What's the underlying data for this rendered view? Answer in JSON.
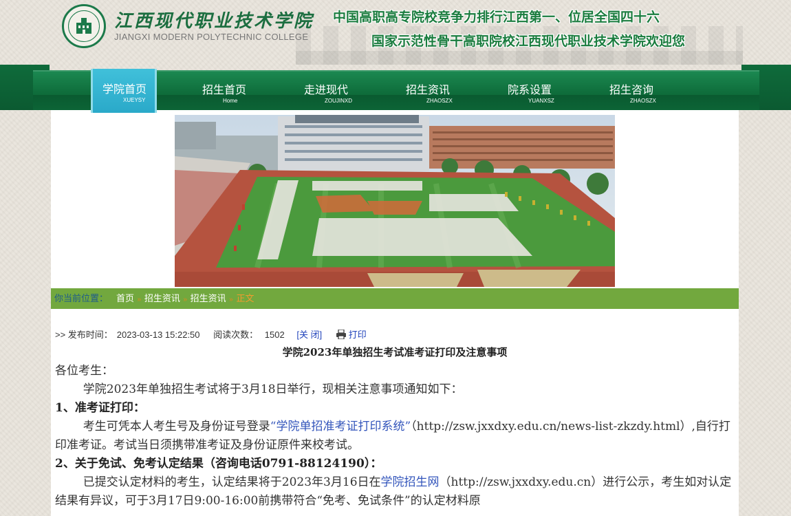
{
  "header": {
    "logo_cn": "江西现代职业技术学院",
    "logo_en": "JIANGXI MODERN POLYTECHNIC COLLEGE",
    "slogan_line1": "中国高职高专院校竞争力排行江西第一、位居全国四十六",
    "slogan_line2": "国家示范性骨干高职院校江西现代职业技术学院欢迎您",
    "brand_color": "#1c7a4a"
  },
  "nav": {
    "items": [
      {
        "label": "学院首页",
        "sub": "XUEYSY",
        "active": true
      },
      {
        "label": "招生首页",
        "sub": "Home"
      },
      {
        "label": "走进现代",
        "sub": "ZOUJINXD"
      },
      {
        "label": "招生资讯",
        "sub": "ZHAOSZX"
      },
      {
        "label": "院系设置",
        "sub": "YUANXSZ"
      },
      {
        "label": "招生咨询",
        "sub": "ZHAOSZX"
      }
    ],
    "active_color": "#2aa9c9",
    "bar_color": "#0f6e3c"
  },
  "breadcrumb": {
    "label": "你当前位置：",
    "items": [
      "首页",
      "招生资讯",
      "招生资讯"
    ],
    "current": "正文",
    "sep": "»"
  },
  "article": {
    "meta_prefix": ">> 发布时间：",
    "publish_time": "2023-03-13 15:22:50",
    "views_label": "阅读次数：",
    "views": "1502",
    "close_label": "[关 闭]",
    "print_label": "打印",
    "title": "学院2023年单独招生考试准考证打印及注意事项",
    "greeting": "各位考生：",
    "intro": "学院2023年单独招生考试将于3月18日举行，现相关注意事项通知如下：",
    "s1_heading": "1、准考证打印：",
    "s1_pre": "考生可凭本人考生号及身份证号登录",
    "s1_link": "“学院单招准考证打印系统”",
    "s1_post": "（http://zsw.jxxdxy.edu.cn/news-list-zkzdy.html）,自行打印准考证。考试当日须携带准考证及身份证原件来校考试。",
    "s2_heading": "2、关于免试、免考认定结果（咨询电话0791-88124190）：",
    "s2_pre": "已提交认定材料的考生，认定结果将于2023年3月16日在",
    "s2_link": "学院招生网",
    "s2_post": "（http://zsw.jxxdxy.edu.cn）进行公示，考生如对认定结果有异议，可于3月17日9:00-16:00前携带符合“免考、免试条件”的认定材料原"
  }
}
